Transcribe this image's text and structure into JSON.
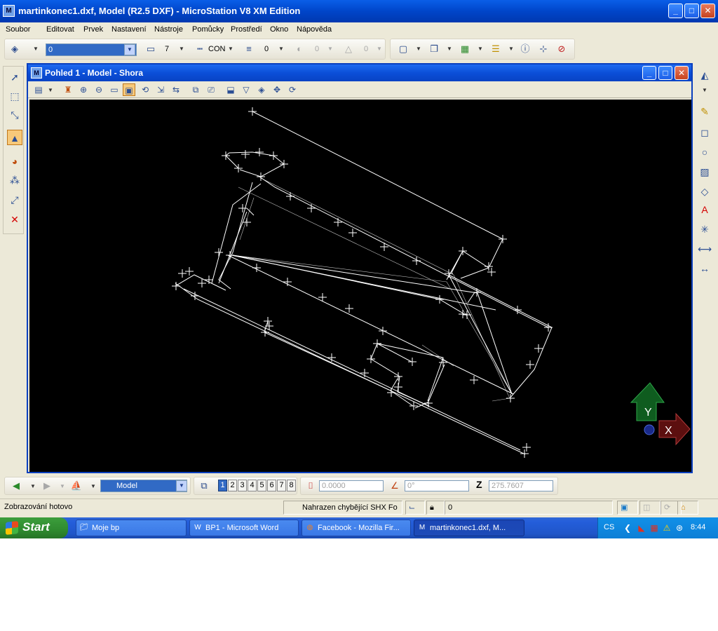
{
  "window": {
    "title": "martinkonec1.dxf, Model (R2.5 DXF) - MicroStation V8 XM Edition",
    "minimize": "_",
    "maximize": "□",
    "close": "✕"
  },
  "menu": {
    "items": [
      "Soubor",
      "Editovat",
      "Prvek",
      "Nastavení",
      "Nástroje",
      "Pomůcky",
      "Prostředí",
      "Okno",
      "Nápověda"
    ]
  },
  "toolbar": {
    "level_value": "0",
    "color_value": "7",
    "style_value": "CON",
    "weight_value": "0",
    "transparency_value": "0",
    "priority_value": "0"
  },
  "view": {
    "title": "Pohled 1 - Model - Shora",
    "minimize": "_",
    "maximize": "□",
    "close": "✕",
    "axis_y": "Y",
    "axis_x": "X"
  },
  "bottom": {
    "model_value": "Model",
    "views": [
      "1",
      "2",
      "3",
      "4",
      "5",
      "6",
      "7",
      "8"
    ],
    "active_view": "1",
    "distance_value": "0.0000",
    "angle_value": "0°",
    "z_label": "Z",
    "z_value": "275.7607"
  },
  "status": {
    "message": "Zobrazování hotovo",
    "font_message": "Nahrazen chybějící SHX Fo",
    "level_value": "0"
  },
  "taskbar": {
    "start": "Start",
    "tasks": [
      {
        "label": "Moje bp",
        "icon": "folder-icon"
      },
      {
        "label": "BP1 - Microsoft Word",
        "icon": "word-icon"
      },
      {
        "label": "Facebook - Mozilla Fir...",
        "icon": "firefox-icon"
      },
      {
        "label": "martinkonec1.dxf, M...",
        "icon": "microstation-icon"
      }
    ],
    "language": "CS",
    "clock": "8:44"
  },
  "colors": {
    "titlebar": "#0045c9",
    "canvas": "#000000",
    "drawing": "#ffffff",
    "axis_y": "#1f7a2a",
    "axis_x": "#8c1b1b"
  }
}
